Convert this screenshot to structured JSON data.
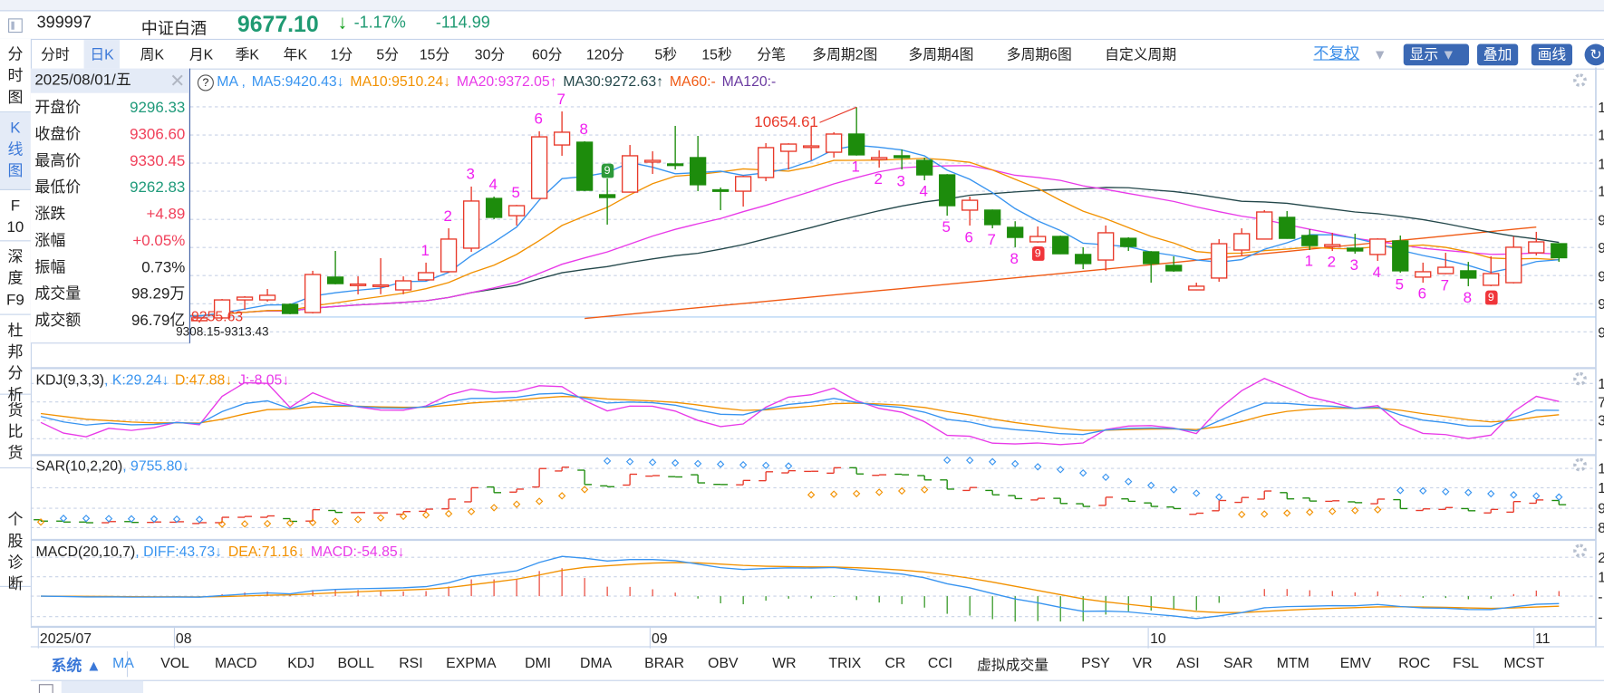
{
  "header": {
    "code": "399997",
    "name": "中证白酒",
    "price": "9677.10",
    "arrow": "↓",
    "pct": "-1.17%",
    "chg": "-114.99"
  },
  "tabs": [
    "分时",
    "日K",
    "周K",
    "月K",
    "季K",
    "年K",
    "1分",
    "5分",
    "15分",
    "30分",
    "60分",
    "120分",
    "5秒",
    "15秒",
    "分笔",
    "多周期2图",
    "多周期4图",
    "多周期6图",
    "自定义周期"
  ],
  "active_tab": "日K",
  "toolbar": {
    "adjust": "不复权",
    "display": "显示",
    "overlay": "叠加",
    "draw": "画线"
  },
  "sidebar": [
    [
      "分",
      "时",
      "图"
    ],
    [
      "K",
      "线",
      "图"
    ],
    [
      "F",
      "10"
    ],
    [
      "深",
      "度",
      "F9"
    ],
    [
      "杜",
      "邦",
      "分",
      "析"
    ],
    [
      "货",
      "比",
      "货"
    ],
    [
      "个",
      "股",
      "诊",
      "断"
    ]
  ],
  "info": {
    "date": "2025/08/01/五",
    "rows": [
      {
        "label": "开盘价",
        "value": "9296.33",
        "color": "g"
      },
      {
        "label": "收盘价",
        "value": "9306.60",
        "color": "r"
      },
      {
        "label": "最高价",
        "value": "9330.45",
        "color": "r"
      },
      {
        "label": "最低价",
        "value": "9262.83",
        "color": "g"
      },
      {
        "label": "涨跌",
        "value": "+4.89",
        "color": "r"
      },
      {
        "label": "涨幅",
        "value": "+0.05%",
        "color": "r"
      },
      {
        "label": "振幅",
        "value": "0.73%",
        "color": "k"
      },
      {
        "label": "成交量",
        "value": "98.29万",
        "color": "k"
      },
      {
        "label": "成交额",
        "value": "96.79亿",
        "color": "k"
      }
    ]
  },
  "ma_header": {
    "name": "MA ,",
    "ma5": "MA5:9420.43↓",
    "ma10": "MA10:9510.24↓",
    "ma20": "MA20:9372.05↑",
    "ma30": "MA30:9272.63↑",
    "ma60": "MA60:-",
    "ma120": "MA120:-"
  },
  "kdj_header": {
    "name": "KDJ(9,3,3)",
    "k": ", K:29.24↓",
    "d": "D:47.88↓",
    "j": "J:-8.05↓"
  },
  "sar_header": {
    "name": "SAR(10,2,20)",
    "v": ", 9755.80↓"
  },
  "macd_header": {
    "name": "MACD(20,10,7)",
    "diff": ", DIFF:43.73↓",
    "dea": "DEA:71.16↓",
    "macd": "MACD:-54.85↓"
  },
  "axis_labels": {
    "main": [
      "1",
      "1",
      "1",
      "1",
      "9",
      "9",
      "9",
      "9",
      "9"
    ],
    "kdj": [
      "1",
      "7",
      "3",
      "-"
    ],
    "sar": [
      "1",
      "1",
      "9",
      "8"
    ],
    "macd": [
      "2",
      "1",
      "-",
      "-"
    ]
  },
  "date_labels": [
    {
      "text": "2025/07",
      "i": 0
    },
    {
      "text": "08",
      "i": 6
    },
    {
      "text": "09",
      "i": 27
    },
    {
      "text": "10",
      "i": 49
    },
    {
      "text": "11",
      "i": 66
    }
  ],
  "indicators": {
    "system": "系统 ▲",
    "items": [
      "MA",
      "VOL",
      "MACD",
      "KDJ",
      "BOLL",
      "RSI",
      "EXPMA",
      "DMI",
      "DMA",
      "BRAR",
      "OBV",
      "WR",
      "TRIX",
      "CR",
      "CCI",
      "虚拟成交量",
      "PSY",
      "VR",
      "ASI",
      "SAR",
      "MTM",
      "EMV",
      "ROC",
      "FSL",
      "MCST"
    ],
    "active": "MA"
  },
  "colors": {
    "up": "#e8392a",
    "down": "#1d8c0c",
    "ma5": "#3894f0",
    "ma10": "#f29100",
    "ma20": "#e83ae8",
    "ma30": "#23474a",
    "ma60": "#f05a14",
    "ma120": "#6a3aa0",
    "td": "#f020f0"
  },
  "chart_data": {
    "type": "candlestick",
    "title": "中证白酒 日K",
    "candles_ohlc": [
      [
        9350,
        9380,
        9300,
        9320
      ],
      [
        9320,
        9345,
        9290,
        9300
      ],
      [
        9300,
        9330,
        9270,
        9285
      ],
      [
        9285,
        9320,
        9275,
        9310
      ],
      [
        9310,
        9320,
        9285,
        9292
      ],
      [
        9292,
        9310,
        9270,
        9301
      ],
      [
        9296.33,
        9330.45,
        9262.83,
        9306.6
      ],
      [
        9268,
        9290,
        9255.63,
        9286
      ],
      [
        9286,
        9409,
        9280,
        9403
      ],
      [
        9403,
        9427,
        9339,
        9421
      ],
      [
        9403,
        9474,
        9392,
        9433
      ],
      [
        9374,
        9380,
        9310,
        9315
      ],
      [
        9321,
        9592,
        9315,
        9568
      ],
      [
        9551,
        9721,
        9504,
        9509
      ],
      [
        9504,
        9556,
        9439,
        9506
      ],
      [
        9498,
        9674,
        9440,
        9500
      ],
      [
        9468,
        9556,
        9440,
        9527
      ],
      [
        9533,
        9645,
        9527,
        9580
      ],
      [
        9586,
        9868,
        9580,
        9798
      ],
      [
        9739,
        10139,
        9715,
        10045
      ],
      [
        10062,
        10074,
        9927,
        9939
      ],
      [
        9950,
        10020,
        9886,
        10015
      ],
      [
        10062,
        10498,
        10062,
        10462
      ],
      [
        10409,
        10627,
        10339,
        10492
      ],
      [
        10427,
        10433,
        10110,
        10115
      ],
      [
        10086,
        10192,
        9892,
        10068
      ],
      [
        10103,
        10409,
        10100,
        10339
      ],
      [
        10298,
        10368,
        10221,
        10309
      ],
      [
        10286,
        10533,
        10250,
        10280
      ],
      [
        10327,
        10468,
        10109,
        10151
      ],
      [
        10118,
        10133,
        9986,
        10115
      ],
      [
        10109,
        10210,
        10009,
        10204
      ],
      [
        10198,
        10421,
        10174,
        10392
      ],
      [
        10368,
        10420,
        10250,
        10415
      ],
      [
        10400,
        10533,
        10309,
        10403
      ],
      [
        10362,
        10492,
        10327,
        10480
      ],
      [
        10480,
        10654.61,
        10340,
        10345
      ],
      [
        10315,
        10374,
        10262,
        10327
      ],
      [
        10339,
        10380,
        10250,
        10327
      ],
      [
        10309,
        10327,
        10180,
        10215
      ],
      [
        10215,
        10220,
        9950,
        10015
      ],
      [
        9986,
        10074,
        9886,
        10050
      ],
      [
        9986,
        9990,
        9868,
        9892
      ],
      [
        9874,
        9914,
        9745,
        9809
      ],
      [
        9780,
        9880,
        9775,
        9815
      ],
      [
        9815,
        9820,
        9700,
        9703
      ],
      [
        9698,
        9745,
        9603,
        9639
      ],
      [
        9662,
        9886,
        9592,
        9839
      ],
      [
        9803,
        9810,
        9721,
        9750
      ],
      [
        9715,
        9720,
        9515,
        9639
      ],
      [
        9627,
        9686,
        9586,
        9592
      ],
      [
        9468,
        9515,
        9465,
        9492
      ],
      [
        9545,
        9798,
        9521,
        9768
      ],
      [
        9727,
        9868,
        9692,
        9833
      ],
      [
        9798,
        9986,
        9795,
        9974
      ],
      [
        9939,
        9980,
        9800,
        9803
      ],
      [
        9821,
        9862,
        9727,
        9756
      ],
      [
        9750,
        9839,
        9721,
        9762
      ],
      [
        9739,
        9833,
        9703,
        9721
      ],
      [
        9698,
        9803,
        9656,
        9798
      ],
      [
        9786,
        9821,
        9580,
        9592
      ],
      [
        9551,
        9645,
        9515,
        9586
      ],
      [
        9574,
        9709,
        9570,
        9615
      ],
      [
        9592,
        9650,
        9492,
        9545
      ],
      [
        9498,
        9686,
        9492,
        9574
      ],
      [
        9515,
        9815,
        9510,
        9745
      ],
      [
        9709,
        9845,
        9692,
        9780
      ],
      [
        9768,
        9770,
        9650,
        9677.1
      ]
    ],
    "ma60_points": [
      {
        "i": 24,
        "v": 9283
      },
      {
        "i": 44,
        "v": 9560
      },
      {
        "i": 66,
        "v": 9876
      }
    ],
    "td_labels": [
      "1",
      "2",
      "3",
      "4",
      "5",
      "6",
      "7",
      "8",
      "9"
    ],
    "td_sequences": [
      {
        "start": 17,
        "pos": "above",
        "type": "up"
      },
      {
        "start": 36,
        "pos": "below",
        "type": "down"
      },
      {
        "start": 56,
        "pos": "below",
        "type": "down"
      }
    ],
    "annotations": {
      "high": {
        "text": "10654.61",
        "i": 36,
        "v": 10654.61
      },
      "low": {
        "text": "9255.63",
        "i": 7,
        "v": 9255.63
      },
      "range": {
        "text": "9308.15-9313.43"
      }
    },
    "kdj_params": [
      9,
      3,
      3
    ],
    "sar_params": [
      10,
      2,
      20
    ],
    "macd_params": [
      20,
      10,
      7
    ]
  }
}
